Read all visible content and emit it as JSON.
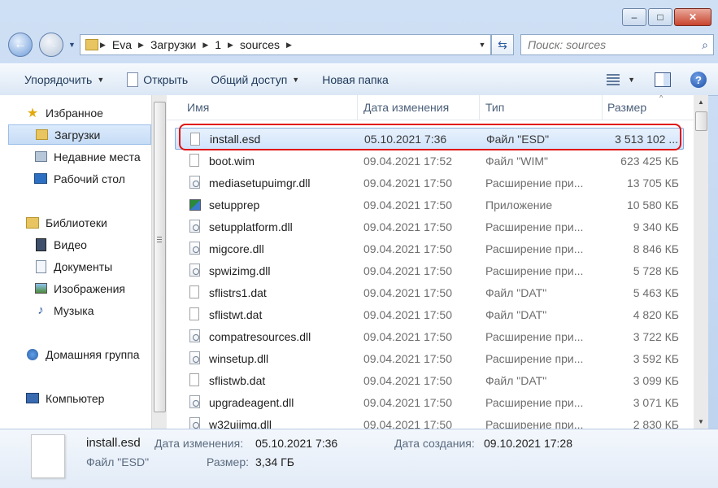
{
  "window": {
    "minimize_symbol": "–",
    "maximize_symbol": "□",
    "close_symbol": "✕"
  },
  "nav": {
    "breadcrumbs": [
      "Eva",
      "Загрузки",
      "1",
      "sources"
    ],
    "search_placeholder": "Поиск: sources"
  },
  "toolbar": {
    "organize": "Упорядочить",
    "open": "Открыть",
    "share": "Общий доступ",
    "new_folder": "Новая папка"
  },
  "sidebar": {
    "favorites": "Избранное",
    "downloads": "Загрузки",
    "recent": "Недавние места",
    "desktop": "Рабочий стол",
    "libraries": "Библиотеки",
    "video": "Видео",
    "documents": "Документы",
    "images": "Изображения",
    "music": "Музыка",
    "homegroup": "Домашняя группа",
    "computer": "Компьютер"
  },
  "columns": {
    "name": "Имя",
    "date": "Дата изменения",
    "type": "Тип",
    "size": "Размер"
  },
  "files": [
    {
      "name": "install.esd",
      "date": "05.10.2021 7:36",
      "type": "Файл \"ESD\"",
      "size": "3 513 102 ...",
      "icon": "doc"
    },
    {
      "name": "boot.wim",
      "date": "09.04.2021 17:52",
      "type": "Файл \"WIM\"",
      "size": "623 425 КБ",
      "icon": "doc"
    },
    {
      "name": "mediasetupuimgr.dll",
      "date": "09.04.2021 17:50",
      "type": "Расширение при...",
      "size": "13 705 КБ",
      "icon": "dll"
    },
    {
      "name": "setupprep",
      "date": "09.04.2021 17:50",
      "type": "Приложение",
      "size": "10 580 КБ",
      "icon": "exe"
    },
    {
      "name": "setupplatform.dll",
      "date": "09.04.2021 17:50",
      "type": "Расширение при...",
      "size": "9 340 КБ",
      "icon": "dll"
    },
    {
      "name": "migcore.dll",
      "date": "09.04.2021 17:50",
      "type": "Расширение при...",
      "size": "8 846 КБ",
      "icon": "dll"
    },
    {
      "name": "spwizimg.dll",
      "date": "09.04.2021 17:50",
      "type": "Расширение при...",
      "size": "5 728 КБ",
      "icon": "dll"
    },
    {
      "name": "sflistrs1.dat",
      "date": "09.04.2021 17:50",
      "type": "Файл \"DAT\"",
      "size": "5 463 КБ",
      "icon": "doc"
    },
    {
      "name": "sflistwt.dat",
      "date": "09.04.2021 17:50",
      "type": "Файл \"DAT\"",
      "size": "4 820 КБ",
      "icon": "doc"
    },
    {
      "name": "compatresources.dll",
      "date": "09.04.2021 17:50",
      "type": "Расширение при...",
      "size": "3 722 КБ",
      "icon": "dll"
    },
    {
      "name": "winsetup.dll",
      "date": "09.04.2021 17:50",
      "type": "Расширение при...",
      "size": "3 592 КБ",
      "icon": "dll"
    },
    {
      "name": "sflistwb.dat",
      "date": "09.04.2021 17:50",
      "type": "Файл \"DAT\"",
      "size": "3 099 КБ",
      "icon": "doc"
    },
    {
      "name": "upgradeagent.dll",
      "date": "09.04.2021 17:50",
      "type": "Расширение при...",
      "size": "3 071 КБ",
      "icon": "dll"
    },
    {
      "name": "w32uiimg.dll",
      "date": "09.04.2021 17:50",
      "type": "Расширение при...",
      "size": "2 830 КБ",
      "icon": "dll"
    }
  ],
  "details": {
    "name": "install.esd",
    "type": "Файл \"ESD\"",
    "modified_label": "Дата изменения:",
    "modified_value": "05.10.2021 7:36",
    "created_label": "Дата создания:",
    "created_value": "09.10.2021 17:28",
    "size_label": "Размер:",
    "size_value": "3,34 ГБ"
  }
}
